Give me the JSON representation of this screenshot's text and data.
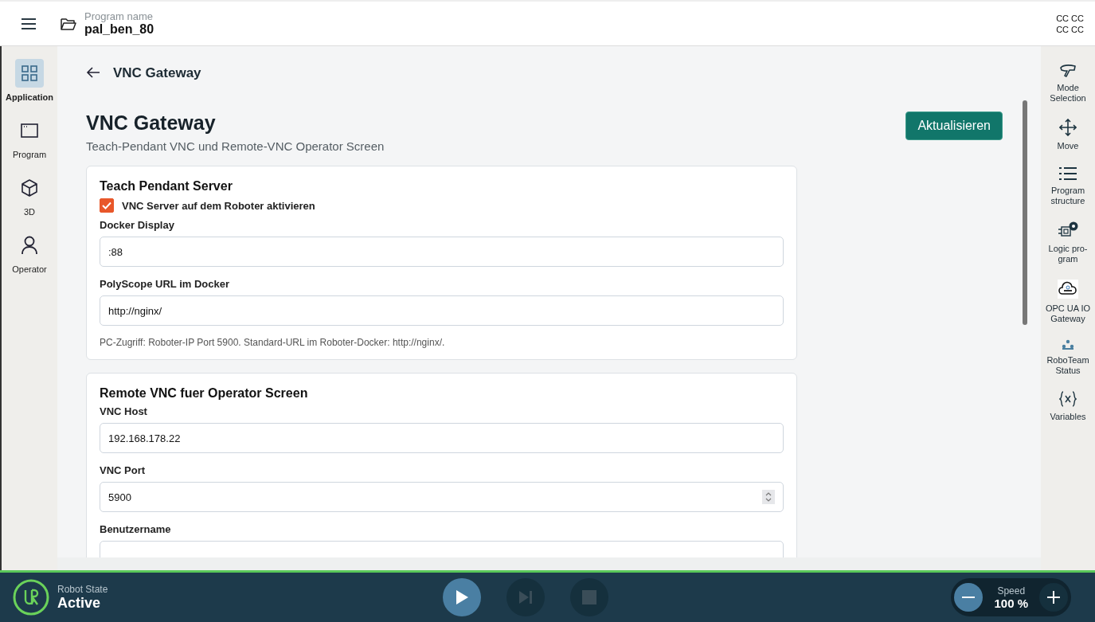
{
  "header": {
    "program_label": "Program name",
    "program_name": "pal_ben_80",
    "corner_lines": [
      "CC CC",
      "CC CC"
    ]
  },
  "left_nav": [
    {
      "label": "Application",
      "selected": true
    },
    {
      "label": "Program",
      "selected": false
    },
    {
      "label": "3D",
      "selected": false
    },
    {
      "label": "Operator",
      "selected": false
    }
  ],
  "breadcrumb": {
    "title": "VNC Gateway"
  },
  "page": {
    "title": "VNC Gateway",
    "subtitle": "Teach-Pendant VNC und Remote-VNC Operator Screen",
    "action": "Aktualisieren"
  },
  "sections": [
    {
      "title": "Teach Pendant Server",
      "items": [
        {
          "kind": "checkbox",
          "label": "VNC Server auf dem Roboter aktivieren",
          "checked": true
        },
        {
          "kind": "text",
          "label": "Docker Display",
          "value": ":88"
        },
        {
          "kind": "text",
          "label": "PolyScope URL im Docker",
          "value": "http://nginx/"
        },
        {
          "kind": "note",
          "text": "PC-Zugriff: Roboter-IP Port 5900. Standard-URL im Roboter-Docker: http://nginx/."
        }
      ]
    },
    {
      "title": "Remote VNC fuer Operator Screen",
      "items": [
        {
          "kind": "text",
          "label": "VNC Host",
          "value": "192.168.178.22"
        },
        {
          "kind": "number",
          "label": "VNC Port",
          "value": "5900"
        },
        {
          "kind": "text",
          "label": "Benutzername"
        }
      ]
    }
  ],
  "right_nav": [
    {
      "label": "Mode Selection"
    },
    {
      "label": "Move"
    },
    {
      "label": "Program structure"
    },
    {
      "label": "Logic pro-gram"
    },
    {
      "label": "OPC UA IO Gateway"
    },
    {
      "label": "RoboTeam Status"
    },
    {
      "label": "Variables"
    }
  ],
  "footer": {
    "state_label": "Robot State",
    "state": "Active",
    "controls": [
      {
        "disabled": false
      },
      {
        "disabled": true
      },
      {
        "disabled": true
      }
    ],
    "speed_label": "Speed",
    "speed": "100 %"
  }
}
